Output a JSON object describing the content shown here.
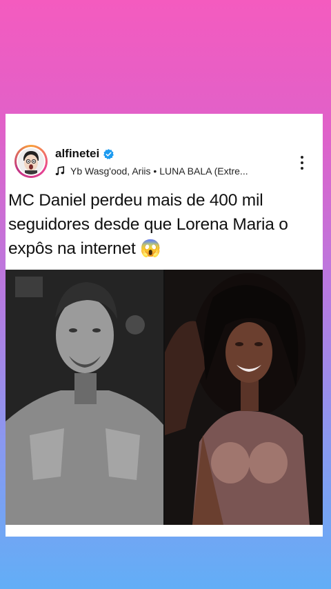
{
  "post": {
    "username": "alfinetei",
    "music": "Yb Wasg'ood, Ariis • LUNA BALA (Extre...",
    "headline_text": "MC Daniel perdeu mais de 400 mil seguidores desde que Lorena Maria o expôs na internet",
    "headline_emoji": "😱"
  },
  "icons": {
    "verified": "verified-badge-icon",
    "music": "music-note-icon",
    "more": "more-vertical-icon"
  },
  "colors": {
    "verified_blue": "#1d9bf0",
    "text": "#111111",
    "background_top": "#f45bbf",
    "background_bottom": "#62aef6"
  }
}
